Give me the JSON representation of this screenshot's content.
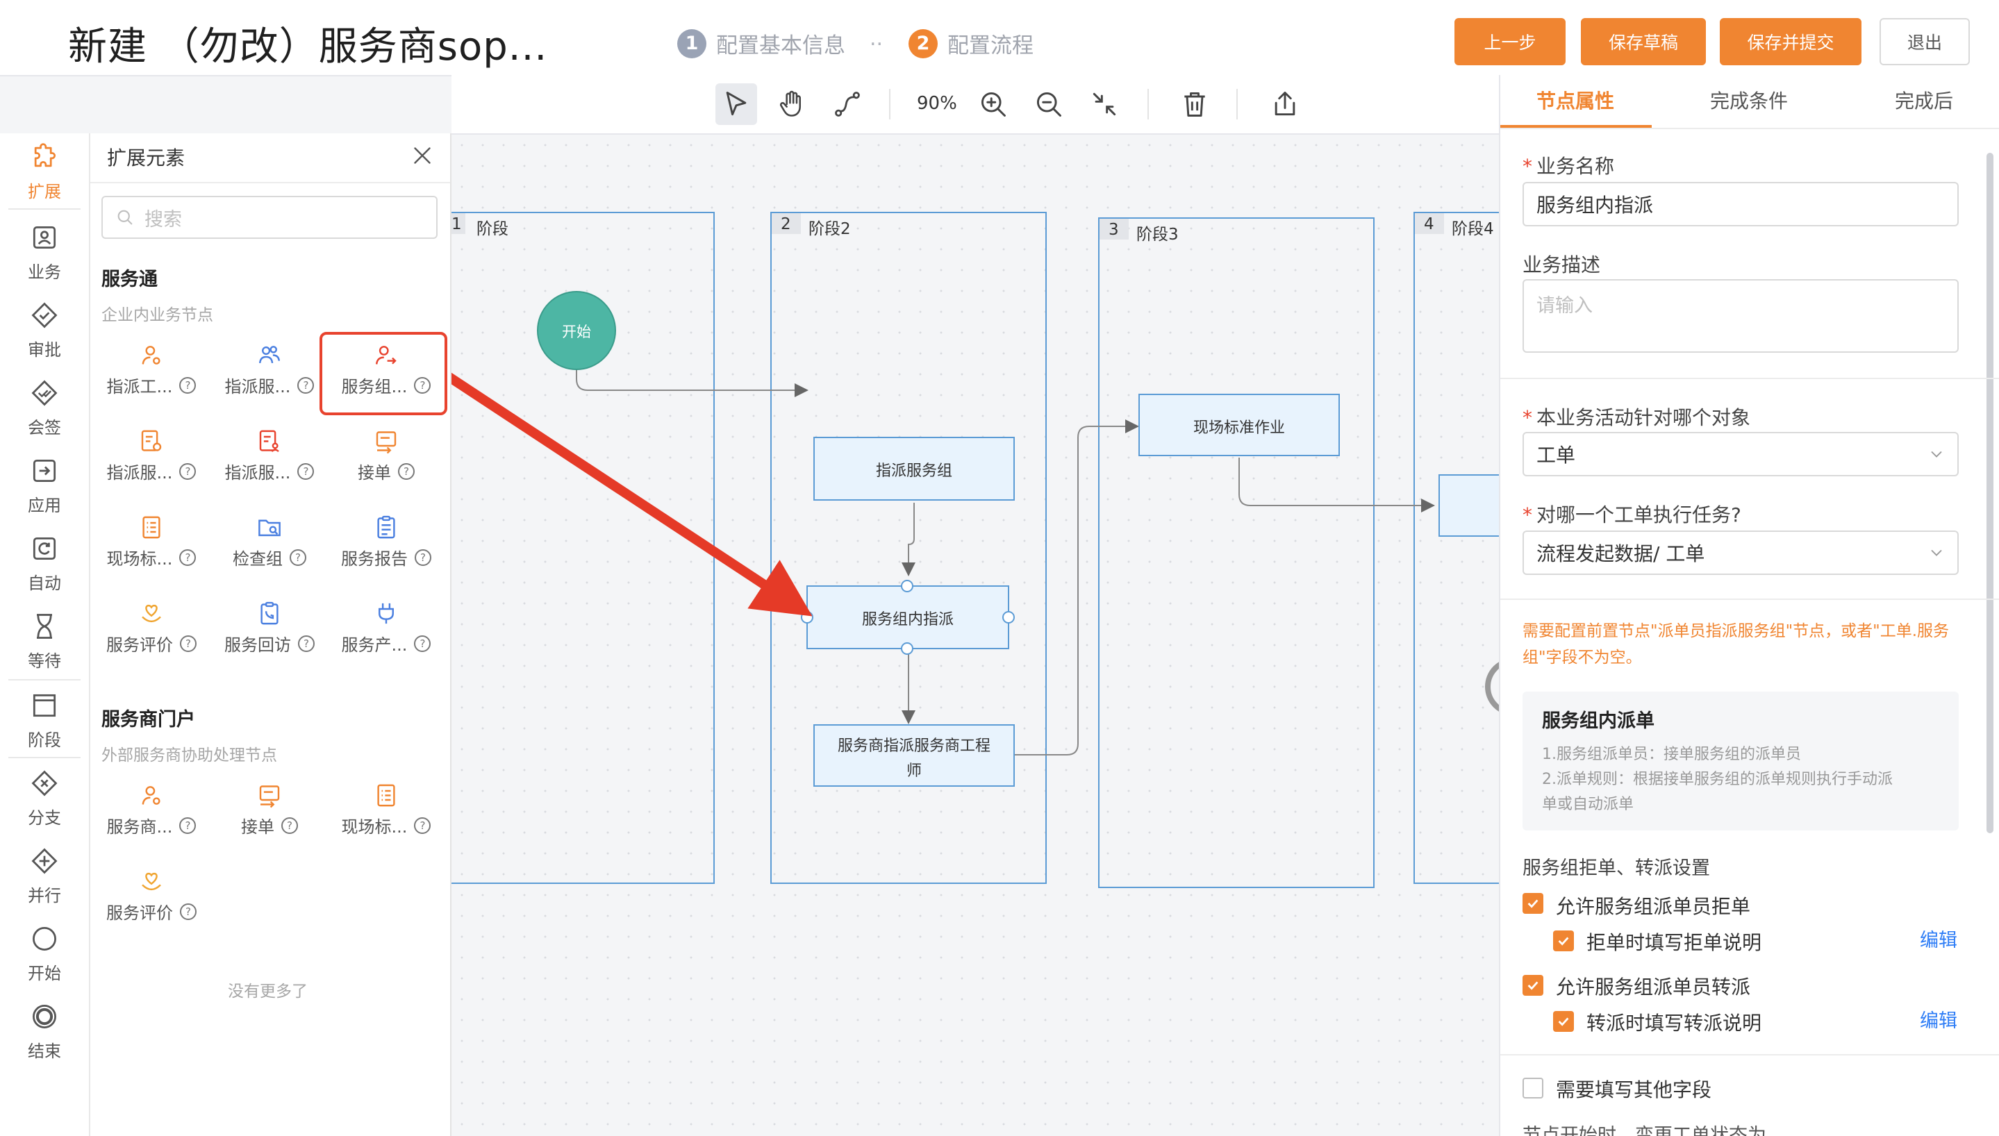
{
  "header": {
    "title": "新建 （勿改）服务商sop...",
    "steps": [
      {
        "num": "1",
        "label": "配置基本信息",
        "state": "done"
      },
      {
        "num": "2",
        "label": "配置流程",
        "state": "active"
      }
    ],
    "step_separator": "..",
    "buttons": {
      "prev": "上一步",
      "save_draft": "保存草稿",
      "save_submit": "保存并提交",
      "exit": "退出"
    }
  },
  "toolbar": {
    "zoom": "90%"
  },
  "rail": [
    {
      "label": "扩展",
      "icon": "puzzle-icon",
      "active": true
    },
    {
      "label": "业务",
      "icon": "business-icon"
    },
    {
      "label": "审批",
      "icon": "approve-icon"
    },
    {
      "label": "会签",
      "icon": "countersign-icon"
    },
    {
      "label": "应用",
      "icon": "app-icon"
    },
    {
      "label": "自动",
      "icon": "auto-icon"
    },
    {
      "label": "等待",
      "icon": "hourglass-icon"
    },
    {
      "label": "阶段",
      "icon": "stage-icon"
    },
    {
      "label": "分支",
      "icon": "branch-icon"
    },
    {
      "label": "并行",
      "icon": "parallel-icon"
    },
    {
      "label": "开始",
      "icon": "start-icon"
    },
    {
      "label": "结束",
      "icon": "end-icon"
    }
  ],
  "ext_panel": {
    "title": "扩展元素",
    "search_placeholder": "搜索",
    "section1": {
      "title": "服务通",
      "subtitle": "企业内业务节点",
      "items": [
        "指派工...",
        "指派服...",
        "服务组...",
        "指派服...",
        "指派服...",
        "接单",
        "现场标...",
        "检查组",
        "服务报告",
        "服务评价",
        "服务回访",
        "服务产..."
      ]
    },
    "section2": {
      "title": "服务商门户",
      "subtitle": "外部服务商协助处理节点",
      "items": [
        "服务商...",
        "接单",
        "现场标...",
        "服务评价"
      ]
    },
    "no_more": "没有更多了"
  },
  "canvas": {
    "stages": [
      {
        "num": "1",
        "label": "阶段"
      },
      {
        "num": "2",
        "label": "阶段2"
      },
      {
        "num": "3",
        "label": "阶段3"
      },
      {
        "num": "4",
        "label": "阶段4"
      }
    ],
    "start_node": "开始",
    "nodes": {
      "assign_group": "指派服务组",
      "group_assign": "服务组内指派",
      "provider_assign_line1": "服务商指派服务商工程",
      "provider_assign_line2": "师",
      "onsite": "现场标准作业"
    }
  },
  "right_panel": {
    "tabs": [
      "节点属性",
      "完成条件",
      "完成后"
    ],
    "business_name_label": "业务名称",
    "business_name_value": "服务组内指派",
    "desc_label": "业务描述",
    "desc_placeholder": "请输入",
    "target_label": "本业务活动针对哪个对象",
    "target_value": "工单",
    "which_label": "对哪一个工单执行任务?",
    "which_value": "流程发起数据/ 工单",
    "warning": "需要配置前置节点\"派单员指派服务组\"节点，或者\"工单.服务组\"字段不为空。",
    "info_title": "服务组内派单",
    "info_line1": "1.服务组派单员：接单服务组的派单员",
    "info_line2": "2.派单规则：根据接单服务组的派单规则执行手动派",
    "info_line3": "单或自动派单",
    "reject_section": "服务组拒单、转派设置",
    "allow_reject": "允许服务组派单员拒单",
    "reject_note": "拒单时填写拒单说明",
    "allow_transfer": "允许服务组派单员转派",
    "transfer_note": "转派时填写转派说明",
    "edit": "编辑",
    "other_fields": "需要填写其他字段",
    "cut_text": "节点开始时，变更工单状态为"
  },
  "colors": {
    "accent": "#f08531",
    "danger": "#e8432e",
    "node_fill": "#e8f3fd",
    "node_border": "#5b9bd5",
    "start_fill": "#4db6a4",
    "link": "#2e7df6"
  }
}
